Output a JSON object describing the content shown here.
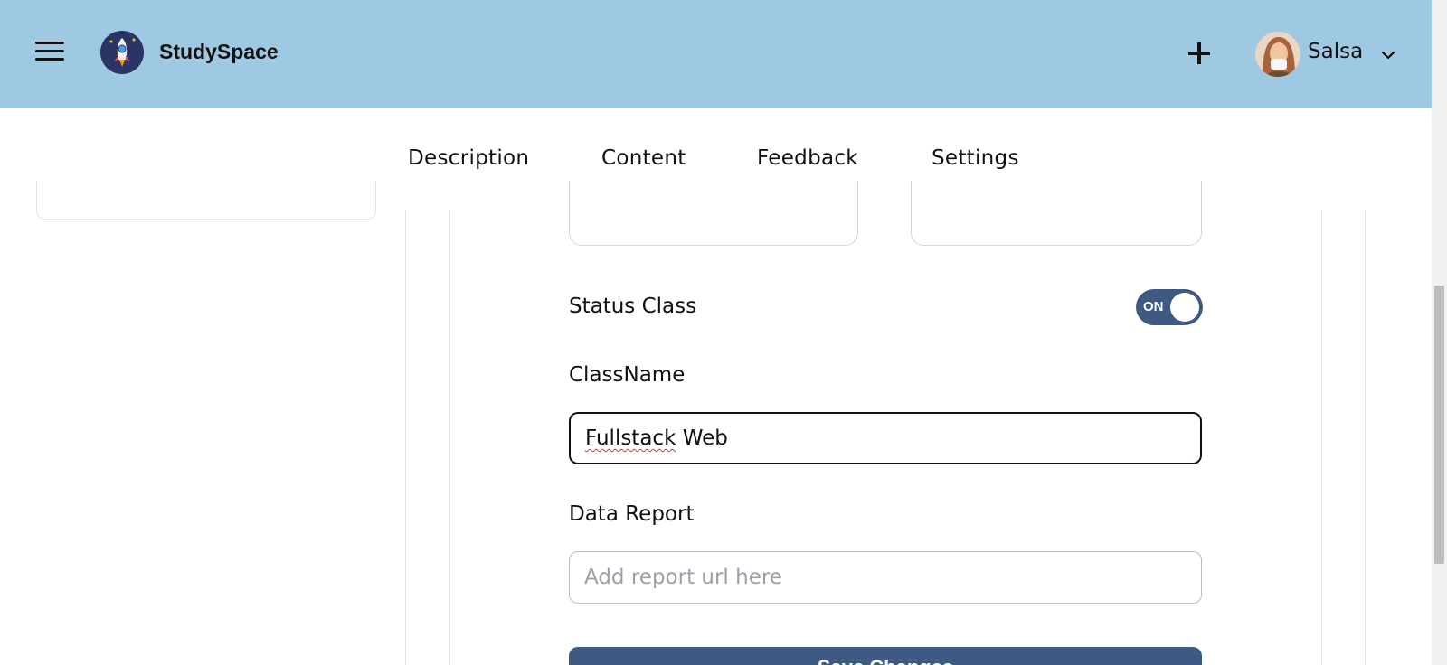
{
  "header": {
    "brand": "StudySpace",
    "user_name": "Salsa"
  },
  "tabs": [
    {
      "label": "Description"
    },
    {
      "label": "Content"
    },
    {
      "label": "Feedback"
    },
    {
      "label": "Settings"
    }
  ],
  "form": {
    "status_label": "Status Class",
    "status_toggle": "ON",
    "classname_label": "ClassName",
    "classname_value_misspelled": "Fullstack",
    "classname_value_rest": " Web",
    "report_label": "Data Report",
    "report_placeholder": "Add report url here",
    "save_button": "Save Changes"
  },
  "colors": {
    "header_bg": "#9fc9e2",
    "accent": "#3f5a82"
  }
}
